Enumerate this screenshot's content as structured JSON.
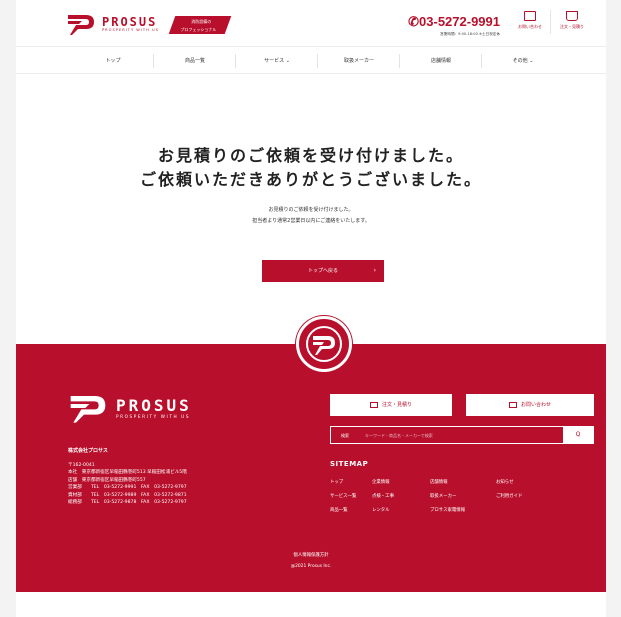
{
  "header": {
    "brand": "PROSUS",
    "brand_sub": "PROSPERITY WITH US",
    "badge_line1": "消防設備の",
    "badge_line2": "プロフェッショナル",
    "phone": "03-5272-9991",
    "hours": "営業時間：9:00-18:00 ※土日祝定休",
    "contact_label": "お問い合わせ",
    "cart_label": "注文・見積り"
  },
  "nav": {
    "items": [
      "トップ",
      "商品一覧",
      "サービス ⌄",
      "取扱メーカー",
      "店舗情報",
      "その他 ⌄"
    ]
  },
  "main": {
    "heading_line1": "お見積りのご依頼を受け付けました。",
    "heading_line2": "ご依頼いただきありがとうございました。",
    "message_line1": "お見積りのご依頼を受け付けました。",
    "message_line2": "担当者より通常2営業日以内にご連絡をいたします。",
    "back_button": "トップへ戻る",
    "back_arrow": "›"
  },
  "footer": {
    "brand": "PROSUS",
    "brand_sub": "PROSPERITY WITH US",
    "company": "株式会社プロサス",
    "address_lines": [
      "〒162-0041",
      "本社　東京都新宿区早稲田鶴巻町513 早稲田松浦ビル5階",
      "店舗　東京都新宿区早稲田鶴巻町557",
      "営業部　　TEL　03-5272-9991　FAX　03-5272-9797",
      "資材部　　TEL　03-5272-9989　FAX　03-5272-9871",
      "総務部　　TEL　03-5272-9878　FAX　03-5272-9797"
    ],
    "order_button": "注文・見積り",
    "contact_button": "お問い合わせ",
    "search_label": "検索",
    "search_placeholder": "キーワード・商品名・メーカーで検索",
    "search_button": "Q",
    "sitemap_title": "SITEMAP",
    "sitemap": [
      [
        "トップ",
        "企業情報",
        "店舗情報",
        "お知らせ"
      ],
      [
        "サービス一覧",
        "点検・工事",
        "取扱メーカー",
        "ご利用ガイド"
      ],
      [
        "商品一覧",
        "レンタル",
        "プロサス家電情報",
        ""
      ]
    ],
    "privacy": "個人情報保護方針",
    "copyright": "@2021 Prosus Inc."
  },
  "colors": {
    "brand": "#b8102c",
    "white": "#ffffff"
  }
}
